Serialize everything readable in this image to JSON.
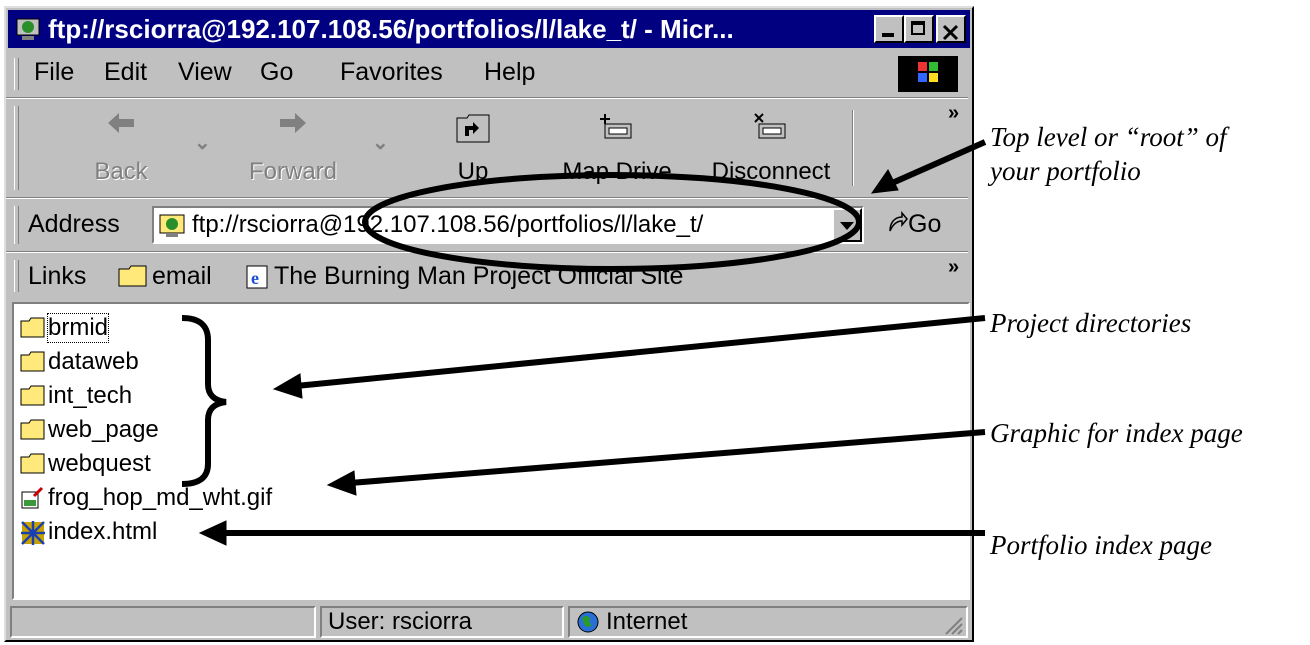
{
  "window": {
    "title": "ftp://rsciorra@192.107.108.56/portfolios/l/lake_t/ - Micr...",
    "controls": {
      "minimize": "_",
      "maximize": "□",
      "close": "×"
    }
  },
  "menu": {
    "items": [
      "File",
      "Edit",
      "View",
      "Go",
      "Favorites",
      "Help"
    ]
  },
  "toolbar": {
    "buttons": [
      {
        "label": "Back",
        "icon": "back-arrow-icon"
      },
      {
        "label": "Forward",
        "icon": "forward-arrow-icon"
      },
      {
        "label": "Up",
        "icon": "up-folder-icon"
      },
      {
        "label": "Map Drive",
        "icon": "map-drive-icon"
      },
      {
        "label": "Disconnect",
        "icon": "disconnect-icon"
      }
    ],
    "more": "»"
  },
  "address": {
    "label": "Address",
    "value": "ftp://rsciorra@192.107.108.56/portfolios/l/lake_t/",
    "go_label": "Go"
  },
  "links": {
    "label": "Links",
    "items": [
      {
        "label": "email",
        "icon": "folder-icon"
      },
      {
        "label": "The Burning Man Project Official Site",
        "icon": "ie-page-icon"
      }
    ],
    "more": "»"
  },
  "files": [
    {
      "name": "brmid",
      "type": "folder"
    },
    {
      "name": "dataweb",
      "type": "folder"
    },
    {
      "name": "int_tech",
      "type": "folder"
    },
    {
      "name": "web_page",
      "type": "folder"
    },
    {
      "name": "webquest",
      "type": "folder"
    },
    {
      "name": "frog_hop_md_wht.gif",
      "type": "gif"
    },
    {
      "name": "index.html",
      "type": "html"
    }
  ],
  "status": {
    "user": "User: rsciorra",
    "zone": "Internet"
  },
  "annotations": {
    "root_line1": "Top level or “root” of",
    "root_line2": "your portfolio",
    "project_dirs": "Project directories",
    "graphic": "Graphic for index page",
    "index": "Portfolio index page"
  },
  "colors": {
    "titlebar": "#000080",
    "chrome": "#c0c0c0",
    "folder": "#ffe97a"
  }
}
